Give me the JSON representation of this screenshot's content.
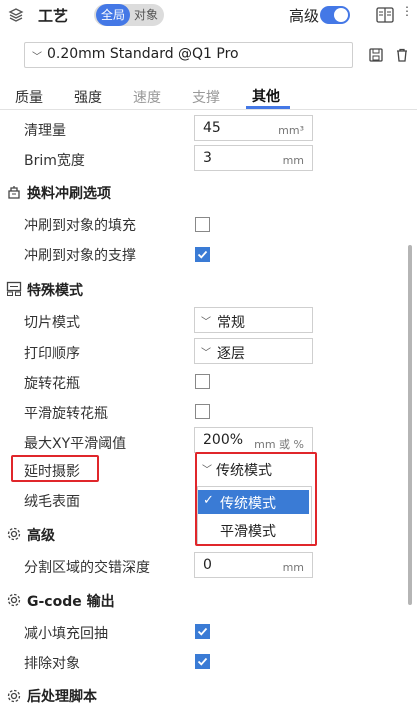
{
  "header": {
    "title": "工艺",
    "mode_global": "全局",
    "mode_object": "对象",
    "advanced_label": "高级",
    "advanced_on": true
  },
  "preset": {
    "name": "0.20mm Standard @Q1 Pro"
  },
  "tabs": [
    {
      "label": "质量"
    },
    {
      "label": "强度"
    },
    {
      "label": "速度"
    },
    {
      "label": "支撑"
    },
    {
      "label": "其他",
      "active": true
    }
  ],
  "rows": {
    "purge": {
      "label": "清理量",
      "value": "45",
      "unit": "mm³"
    },
    "brim": {
      "label": "Brim宽度",
      "value": "3",
      "unit": "mm"
    }
  },
  "sections": {
    "flush": {
      "title": "换料冲刷选项"
    },
    "special": {
      "title": "特殊模式"
    },
    "advanced": {
      "title": "高级"
    },
    "gcode": {
      "title": "G-code 输出"
    },
    "post": {
      "title": "后处理脚本"
    }
  },
  "flush": {
    "infill": {
      "label": "冲刷到对象的填充",
      "checked": false
    },
    "support": {
      "label": "冲刷到对象的支撑",
      "checked": true
    }
  },
  "special": {
    "slice_mode": {
      "label": "切片模式",
      "value": "常规"
    },
    "print_seq": {
      "label": "打印顺序",
      "value": "逐层"
    },
    "spiral": {
      "label": "旋转花瓶",
      "checked": false
    },
    "smooth_spiral": {
      "label": "平滑旋转花瓶",
      "checked": false
    },
    "max_xy": {
      "label": "最大XY平滑阈值",
      "value": "200%",
      "unit": "mm 或 %"
    },
    "timelapse": {
      "label": "延时摄影",
      "value": "传统模式"
    },
    "fuzzy": {
      "label": "绒毛表面"
    }
  },
  "dropdown": {
    "options": [
      {
        "label": "传统模式",
        "selected": true
      },
      {
        "label": "平滑模式",
        "selected": false
      }
    ]
  },
  "advanced": {
    "interlock": {
      "label": "分割区域的交错深度",
      "value": "0",
      "unit": "mm"
    }
  },
  "gcode": {
    "reduce_retract": {
      "label": "减小填充回抽",
      "checked": true
    },
    "exclude": {
      "label": "排除对象",
      "checked": true
    }
  },
  "colors": {
    "accent": "#4478e6",
    "highlight": "#e0262b"
  }
}
